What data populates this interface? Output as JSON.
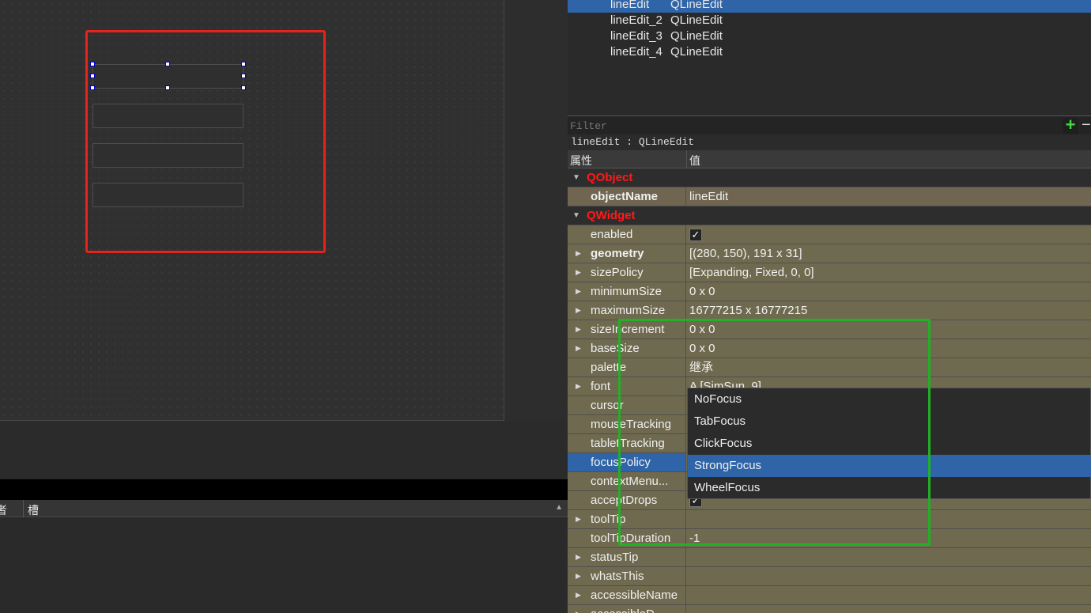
{
  "object_inspector": {
    "rows": [
      {
        "name": "lineEdit",
        "class": "QLineEdit",
        "selected": true
      },
      {
        "name": "lineEdit_2",
        "class": "QLineEdit",
        "selected": false
      },
      {
        "name": "lineEdit_3",
        "class": "QLineEdit",
        "selected": false
      },
      {
        "name": "lineEdit_4",
        "class": "QLineEdit",
        "selected": false
      }
    ]
  },
  "property_editor": {
    "filter_placeholder": "Filter",
    "add_label": "+",
    "remove_label": "−",
    "class_label": "lineEdit : QLineEdit",
    "header_property": "属性",
    "header_value": "值"
  },
  "properties": [
    {
      "type": "category",
      "label": "QObject"
    },
    {
      "type": "prop",
      "name": "objectName",
      "value": "lineEdit",
      "bold": true,
      "expand": false
    },
    {
      "type": "category",
      "label": "QWidget"
    },
    {
      "type": "prop",
      "name": "enabled",
      "check": true,
      "expand": false
    },
    {
      "type": "prop",
      "name": "geometry",
      "value": "[(280, 150), 191 x 31]",
      "bold": true,
      "expand": true
    },
    {
      "type": "prop",
      "name": "sizePolicy",
      "value": "[Expanding, Fixed, 0, 0]",
      "expand": true
    },
    {
      "type": "prop",
      "name": "minimumSize",
      "value": "0 x 0",
      "expand": true
    },
    {
      "type": "prop",
      "name": "maximumSize",
      "value": "16777215 x 16777215",
      "expand": true
    },
    {
      "type": "prop",
      "name": "sizeIncrement",
      "value": "0 x 0",
      "expand": true
    },
    {
      "type": "prop",
      "name": "baseSize",
      "value": "0 x 0",
      "expand": true
    },
    {
      "type": "prop",
      "name": "palette",
      "value": "继承",
      "expand": false
    },
    {
      "type": "prop",
      "name": "font",
      "value": "A [SimSun, 9]",
      "expand": true
    },
    {
      "type": "prop",
      "name": "cursor",
      "value": "",
      "expand": false
    },
    {
      "type": "prop",
      "name": "mouseTracking",
      "value": "",
      "expand": false
    },
    {
      "type": "prop",
      "name": "tabletTracking",
      "value": "",
      "expand": false
    },
    {
      "type": "prop",
      "name": "focusPolicy",
      "value": "",
      "expand": false,
      "selected": true
    },
    {
      "type": "prop",
      "name": "contextMenu...",
      "value": "",
      "expand": false
    },
    {
      "type": "prop",
      "name": "acceptDrops",
      "check": true,
      "expand": false
    },
    {
      "type": "prop",
      "name": "toolTip",
      "value": "",
      "expand": true
    },
    {
      "type": "prop",
      "name": "toolTipDuration",
      "value": "-1",
      "expand": false
    },
    {
      "type": "prop",
      "name": "statusTip",
      "value": "",
      "expand": true
    },
    {
      "type": "prop",
      "name": "whatsThis",
      "value": "",
      "expand": true
    },
    {
      "type": "prop",
      "name": "accessibleName",
      "value": "",
      "expand": true
    },
    {
      "type": "prop",
      "name": "accessibleD...",
      "value": "",
      "expand": true
    }
  ],
  "focus_dropdown": {
    "options": [
      "NoFocus",
      "TabFocus",
      "ClickFocus",
      "StrongFocus",
      "WheelFocus"
    ],
    "selected": "StrongFocus"
  },
  "signal_slot_editor": {
    "col_receiver": "者",
    "col_slot": "槽"
  },
  "checkmark": "✓",
  "colors": {
    "selection": "#2f65a8",
    "category_text": "#ff1a1a",
    "property_bg": "#6f6a4f",
    "highlight_red": "#e5231b",
    "highlight_green": "#22b026"
  }
}
